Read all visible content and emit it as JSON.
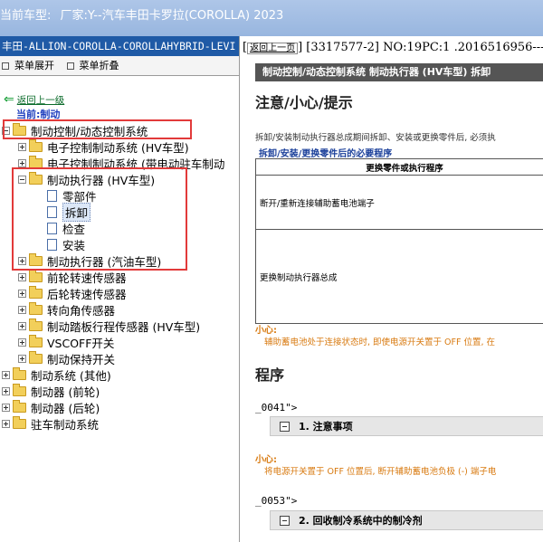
{
  "header": {
    "vehicle_label": "当前车型:",
    "vehicle_value": "厂家:Y--汽车丰田卡罗拉(COROLLA) 2023"
  },
  "left": {
    "panel_title": "丰田-ALLION-COROLLA-COROLLAHYBRID-LEVI",
    "expand_all": "菜单展开",
    "collapse_all": "菜单折叠",
    "back_link": "返回上一级",
    "current_label": "当前:制动",
    "tree": [
      {
        "label": "制动控制/动态控制系统",
        "level": 1,
        "type": "folder",
        "expanded": true
      },
      {
        "label": "电子控制制动系统 (HV车型)",
        "level": 2,
        "type": "folder"
      },
      {
        "label": "电子控制制动系统 (带电动驻车制动",
        "level": 2,
        "type": "folder"
      },
      {
        "label": "制动执行器 (HV车型)",
        "level": 2,
        "type": "folder",
        "expanded": true
      },
      {
        "label": "零部件",
        "level": 3,
        "type": "doc"
      },
      {
        "label": "拆卸",
        "level": 3,
        "type": "doc",
        "selected": true
      },
      {
        "label": "检查",
        "level": 3,
        "type": "doc"
      },
      {
        "label": "安装",
        "level": 3,
        "type": "doc"
      },
      {
        "label": "制动执行器 (汽油车型)",
        "level": 2,
        "type": "folder"
      },
      {
        "label": "前轮转速传感器",
        "level": 2,
        "type": "folder"
      },
      {
        "label": "后轮转速传感器",
        "level": 2,
        "type": "folder"
      },
      {
        "label": "转向角传感器",
        "level": 2,
        "type": "folder"
      },
      {
        "label": "制动踏板行程传感器 (HV车型)",
        "level": 2,
        "type": "folder"
      },
      {
        "label": "VSCOFF开关",
        "level": 2,
        "type": "folder"
      },
      {
        "label": "制动保持开关",
        "level": 2,
        "type": "folder"
      },
      {
        "label": "制动系统 (其他)",
        "level": 1,
        "type": "folder"
      },
      {
        "label": "制动器 (前轮)",
        "level": 1,
        "type": "folder"
      },
      {
        "label": "制动器 (后轮)",
        "level": 1,
        "type": "folder"
      },
      {
        "label": "驻车制动系统",
        "level": 1,
        "type": "folder"
      }
    ]
  },
  "right": {
    "back_btn": "返回上一页",
    "doc_id": "[3317577-2] NO:19PC:1 .2016516956---",
    "section_bar": "制动控制/动态控制系统  制动执行器 (HV车型)  拆卸",
    "heading_notice": "注意/小心/提示",
    "notice_text": "拆卸/安装制动执行器总成期间拆卸、安装或更换零件后, 必须执",
    "subtitle": "拆卸/安装/更换零件后的必要程序",
    "table_header": "更换零件或执行程序",
    "table_rows": [
      "断开/重新连接辅助蓄电池端子",
      "更换制动执行器总成"
    ],
    "caution_label": "小心:",
    "caution_text_1": "辅助蓄电池处于连接状态时, 即使电源开关置于 OFF 位置, 在",
    "heading_procedure": "程序",
    "code_1": "_0041\">",
    "step_1": "1. 注意事项",
    "caution_text_2": "将电源开关置于 OFF 位置后, 断开辅助蓄电池负极 (-) 端子电",
    "code_2": "_0053\">",
    "step_2": "2. 回收制冷系统中的制冷剂"
  }
}
